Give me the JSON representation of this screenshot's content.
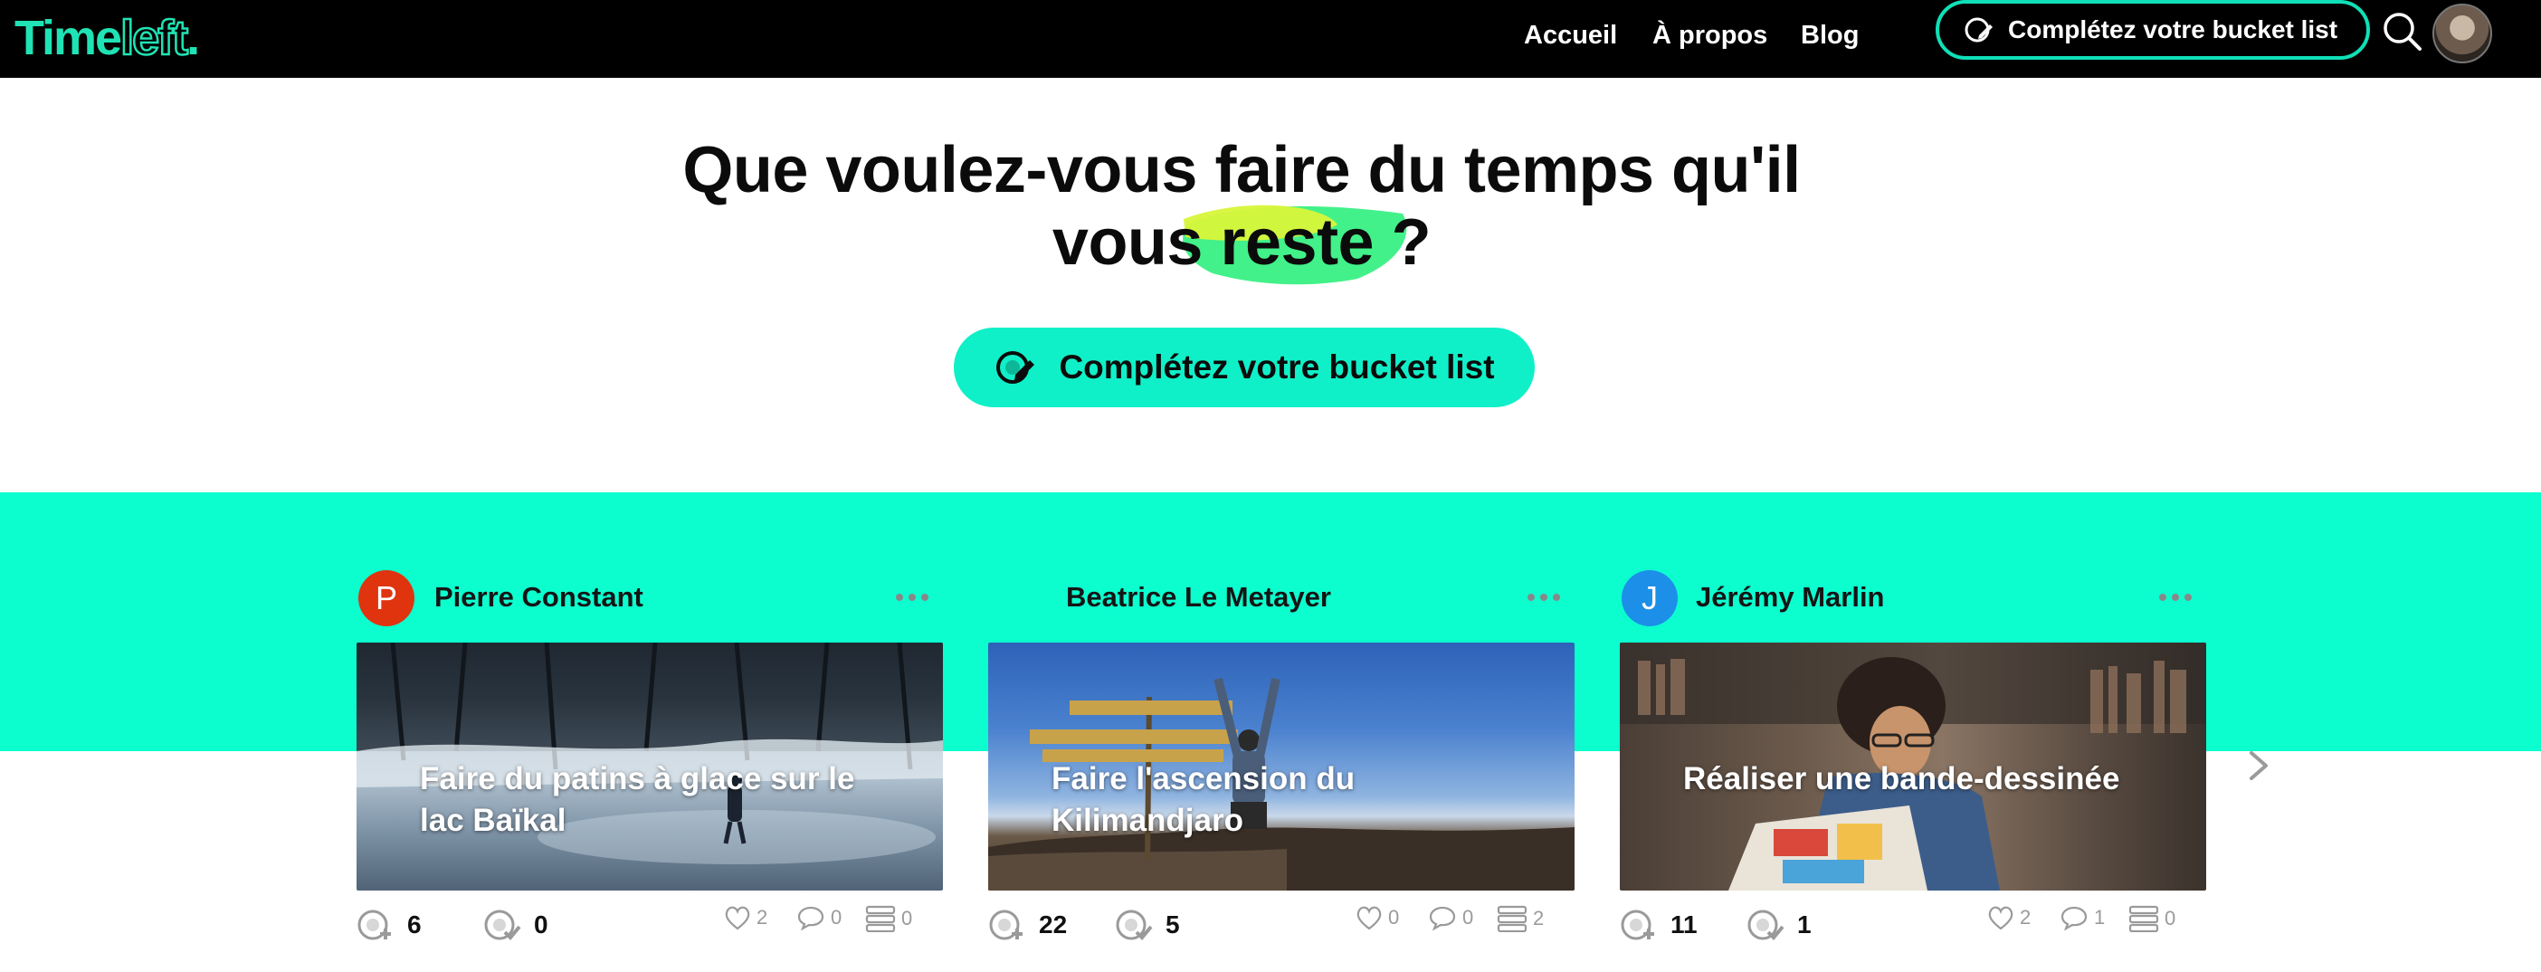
{
  "nav": {
    "logo_solid": "Time",
    "logo_outline": "left",
    "logo_dot": ".",
    "links": [
      "Accueil",
      "À propos",
      "Blog"
    ],
    "cta_label": "Complétez votre bucket list"
  },
  "hero": {
    "title_line1": "Que voulez-vous faire du temps qu'il",
    "title_line2": "vous reste ?",
    "cta_label": "Complétez votre bucket list"
  },
  "cards": [
    {
      "author": "Pierre Constant",
      "initial": "P",
      "avatar_color": "#e0340f",
      "title": "Faire du patins à glace sur le lac Baïkal",
      "adds": "6",
      "done": "0",
      "likes": "2",
      "comments": "0",
      "lists": "0"
    },
    {
      "author": "Beatrice Le Metayer",
      "initial": "",
      "avatar_color": "",
      "title": "Faire l'ascension du Kilimandjaro",
      "adds": "22",
      "done": "5",
      "likes": "0",
      "comments": "0",
      "lists": "2"
    },
    {
      "author": "Jérémy Marlin",
      "initial": "J",
      "avatar_color": "#1c8fe8",
      "title": "Réaliser une bande-dessinée",
      "adds": "11",
      "done": "1",
      "likes": "2",
      "comments": "1",
      "lists": "0"
    }
  ],
  "colors": {
    "accent": "#0cfecf",
    "cta": "#0ff0c8",
    "nav_bg": "#000000",
    "logo": "#1fe3b4"
  }
}
